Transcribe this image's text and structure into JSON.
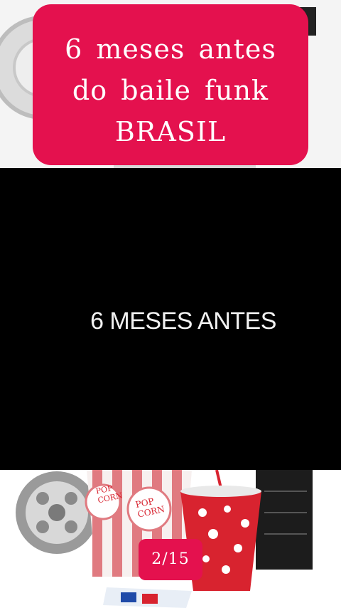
{
  "title_card": {
    "lines": [
      "6  meses  antes",
      "do  baile  funk",
      "BRASIL"
    ]
  },
  "video": {
    "caption": "6 MESES ANTES"
  },
  "popcorn_box_text": [
    "POP",
    "CORN"
  ],
  "pagination": {
    "label": "2/15"
  },
  "colors": {
    "accent": "#e4114e",
    "video_bg": "#000000",
    "popcorn_red": "#d8232f"
  }
}
